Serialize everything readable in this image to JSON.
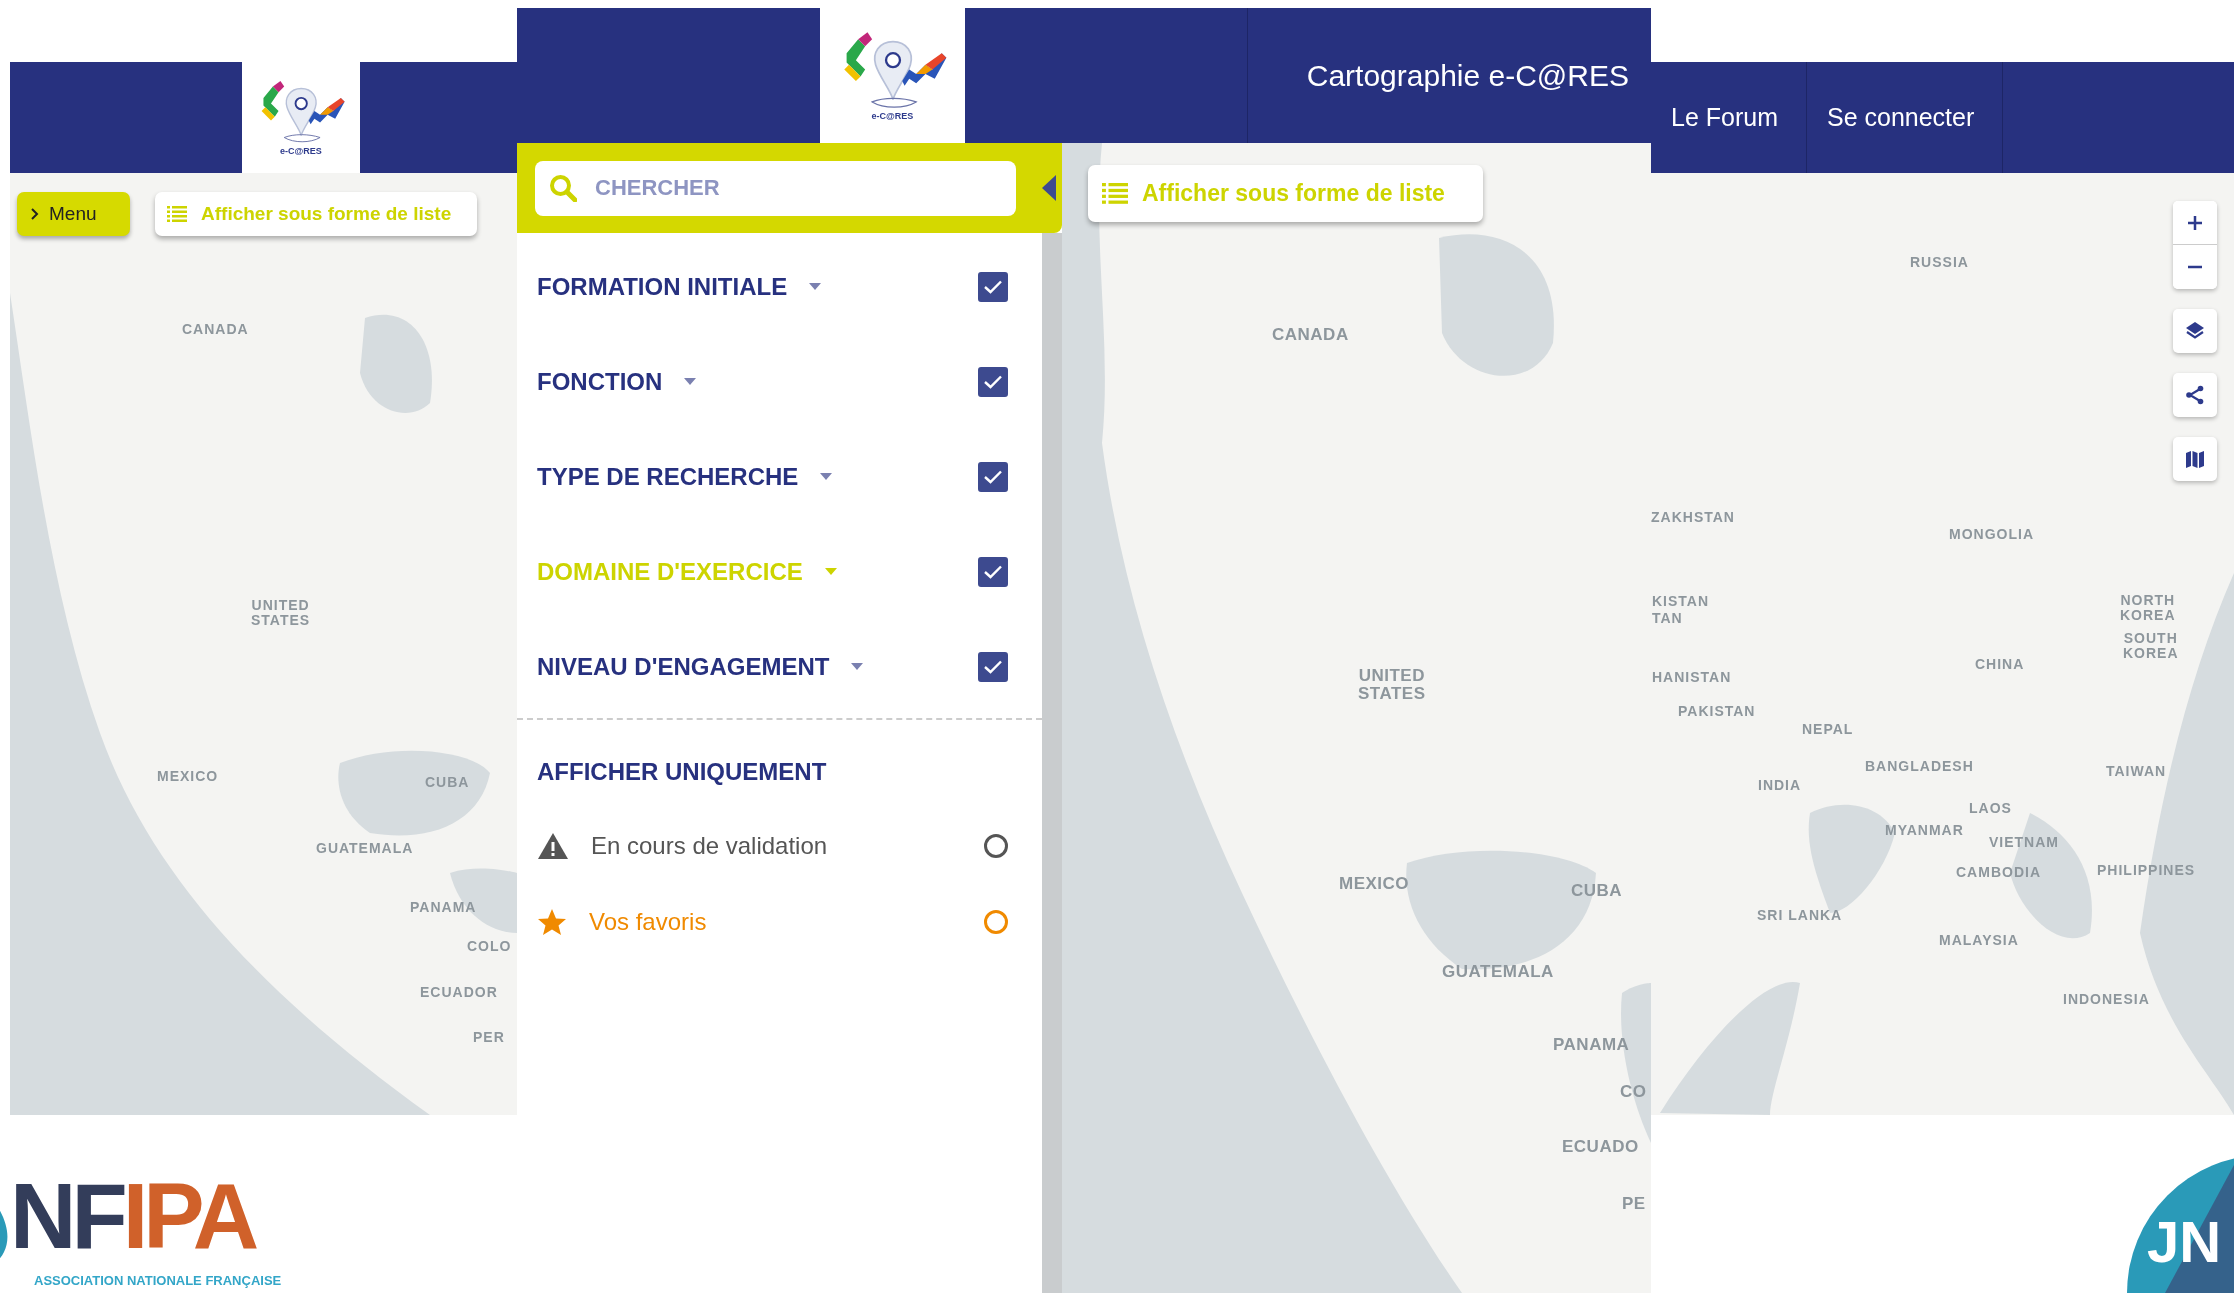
{
  "background_page": {
    "logo": {
      "text": "e-C@RES"
    },
    "nav": [
      {
        "label": "Le Forum"
      },
      {
        "label": "Se connecter"
      }
    ],
    "menu_button": {
      "label": "Menu"
    },
    "list_button": {
      "label": "Afficher sous forme de liste"
    },
    "west_map_labels": [
      "CANADA",
      "UNITED STATES",
      "MEXICO",
      "CUBA",
      "GUATEMALA",
      "PANAMA",
      "COLO",
      "ECUADOR",
      "PER"
    ],
    "east_map_labels": [
      "RUSSIA",
      "ZAKHSTAN",
      "MONGOLIA",
      "KISTAN",
      "TAN",
      "NORTH KOREA",
      "CHINA",
      "SOUTH KOREA",
      "HANISTAN",
      "PAKISTAN",
      "NEPAL",
      "BANGLADESH",
      "TAIWAN",
      "INDIA",
      "LAOS",
      "MYANMAR",
      "VIETNAM",
      "PHILIPPINES",
      "CAMBODIA",
      "SRI LANKA",
      "MALAYSIA",
      "INDONESIA"
    ]
  },
  "front_page": {
    "logo": {
      "text": "e-C@RES"
    },
    "title": "Cartographie e-C@RES",
    "search": {
      "placeholder": "CHERCHER"
    },
    "filters": [
      {
        "label": "FORMATION INITIALE",
        "selected": false,
        "checked": true
      },
      {
        "label": "FONCTION",
        "selected": false,
        "checked": true
      },
      {
        "label": "TYPE DE RECHERCHE",
        "selected": false,
        "checked": true
      },
      {
        "label": "DOMAINE D'EXERCICE",
        "selected": true,
        "checked": true
      },
      {
        "label": "NIVEAU D'ENGAGEMENT",
        "selected": false,
        "checked": true
      }
    ],
    "show_only": {
      "title": "AFFICHER UNIQUEMENT",
      "options": [
        {
          "kind": "pending",
          "label": "En cours de validation",
          "selected": false
        },
        {
          "kind": "favorite",
          "label": "Vos favoris",
          "selected": false
        }
      ]
    },
    "list_button": {
      "label": "Afficher sous forme de liste"
    },
    "map_labels": [
      "CANADA",
      "UNITED STATES",
      "MEXICO",
      "CUBA",
      "GUATEMALA",
      "PANAMA",
      "CO",
      "ECUADO",
      "PE"
    ]
  },
  "footer_logos": [
    {
      "kind": "anfipa",
      "parts": [
        "NF",
        "IPA"
      ],
      "subtitle": "ASSOCIATION NATIONALE FRANÇAISE"
    },
    {
      "kind": "jn",
      "text": "JN"
    }
  ]
}
